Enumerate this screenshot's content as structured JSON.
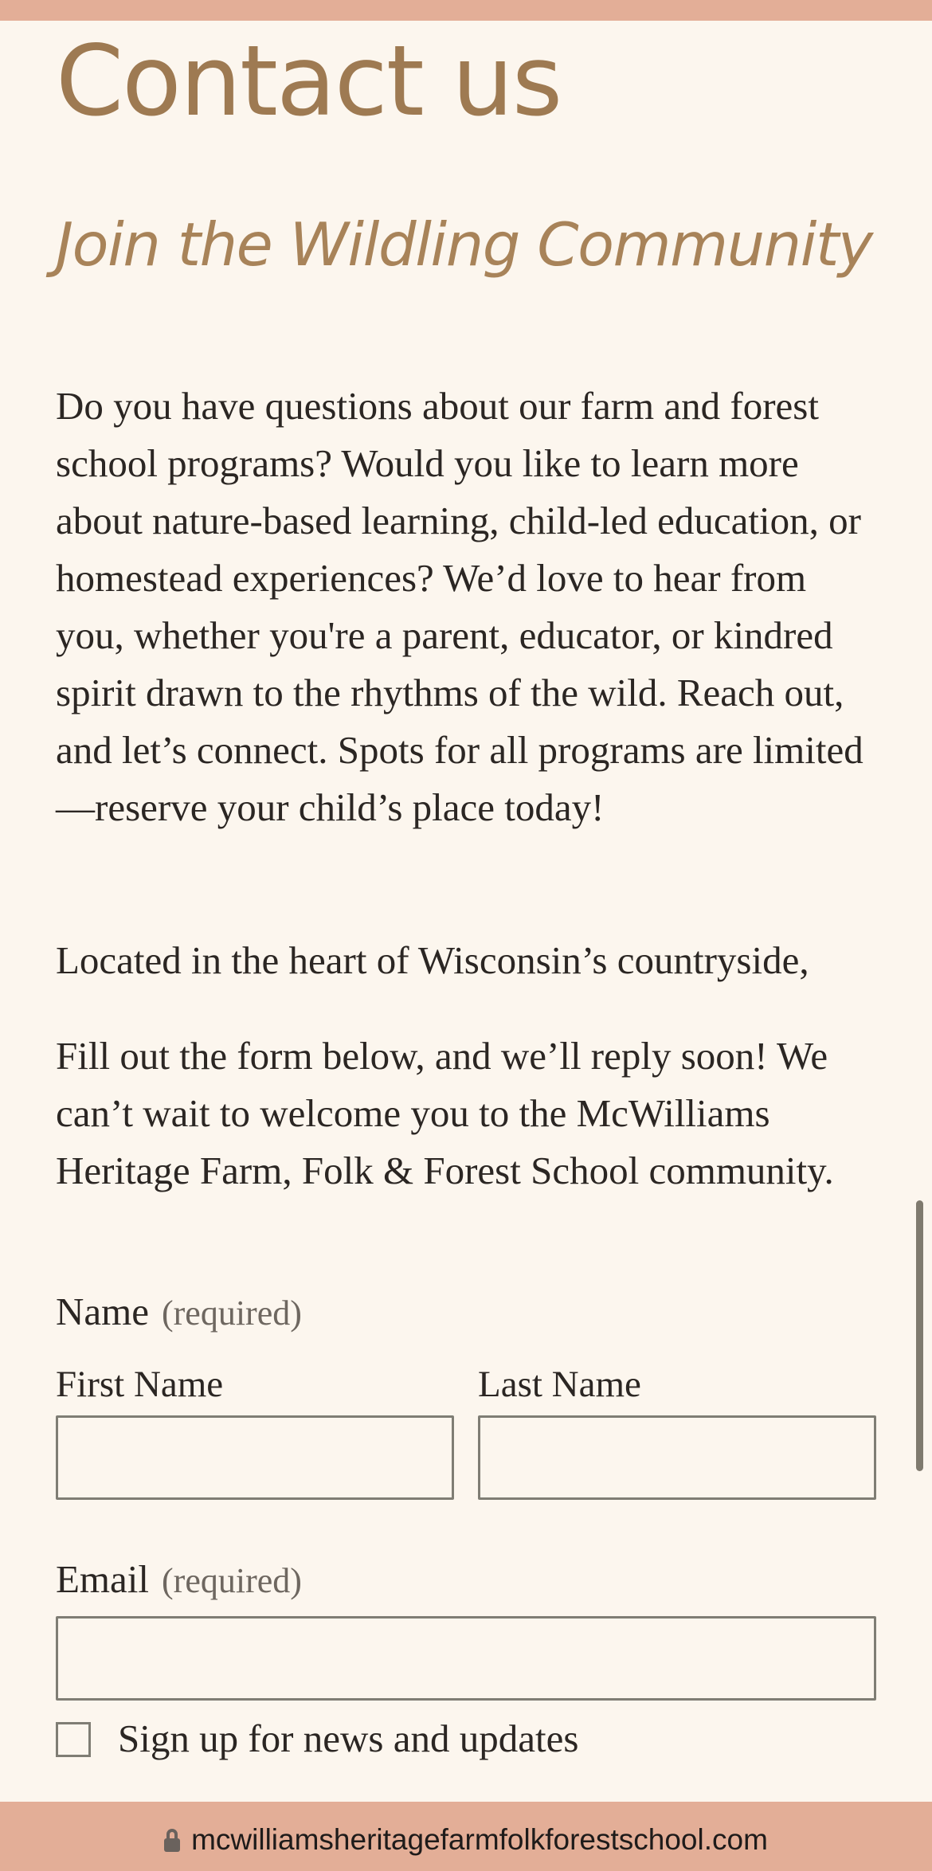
{
  "page": {
    "title": "Contact us",
    "subtitle": "Join the Wildling Community",
    "paragraphs": [
      "Do you have questions about our farm and forest school programs? Would you like to learn more about nature-based learning, child-led education, or homestead experiences? We’d love to hear from you, whether you're a parent, educator, or kindred spirit drawn to the rhythms of the wild. Reach out, and let’s connect. Spots for all programs are limited—reserve your child’s place today!",
      "Located in the heart of Wisconsin’s countryside,",
      "Fill out the form below, and we’ll reply soon! We can’t wait to welcome you to the McWilliams Heritage Farm, Folk & Forest School community."
    ]
  },
  "form": {
    "name_label": "Name",
    "name_required": "(required)",
    "first_name_label": "First Name",
    "first_name_value": "",
    "last_name_label": "Last Name",
    "last_name_value": "",
    "email_label": "Email",
    "email_required": "(required)",
    "email_value": "",
    "newsletter_label": "Sign up for news and updates",
    "newsletter_checked": false
  },
  "browser": {
    "url": "mcwilliamsheritagefarmfolkforestschool.com",
    "lock_icon": "lock-icon"
  },
  "colors": {
    "accent": "#e3ae97",
    "heading": "#9e7a52",
    "background": "#fcf6ee"
  }
}
